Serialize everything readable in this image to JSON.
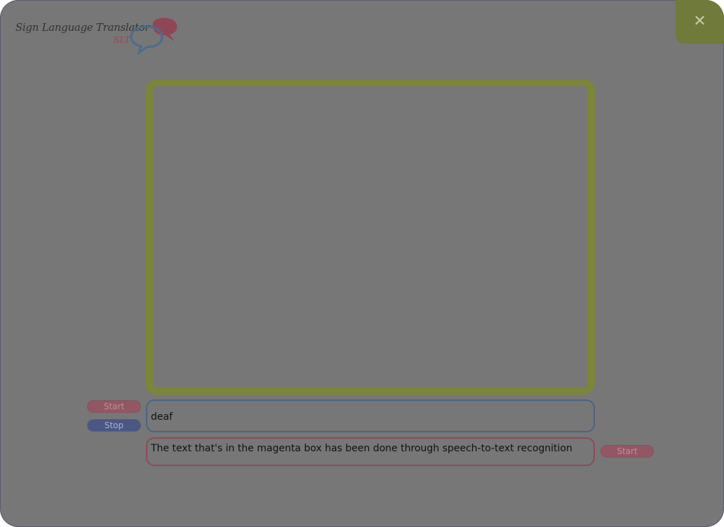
{
  "app": {
    "title": "Sign Language Translator",
    "abbreviation": "SLT"
  },
  "window": {
    "close_symbol": "✕",
    "close_icon": "close-icon"
  },
  "colors": {
    "window_background": "#777777",
    "video_frame_border": "#7c8538",
    "close_button": "#6f7a3b",
    "sign_box_border": "#4b6387",
    "speech_box_border": "#8c4a5b",
    "start_button": "#935763",
    "stop_button": "#4a5684"
  },
  "sign_controls": {
    "start_label": "Start",
    "stop_label": "Stop"
  },
  "sign_output": {
    "value": "deaf"
  },
  "speech_output": {
    "value": "The text that's in the magenta box has been done through speech-to-text recognition"
  },
  "speech_controls": {
    "start_label": "Start"
  }
}
